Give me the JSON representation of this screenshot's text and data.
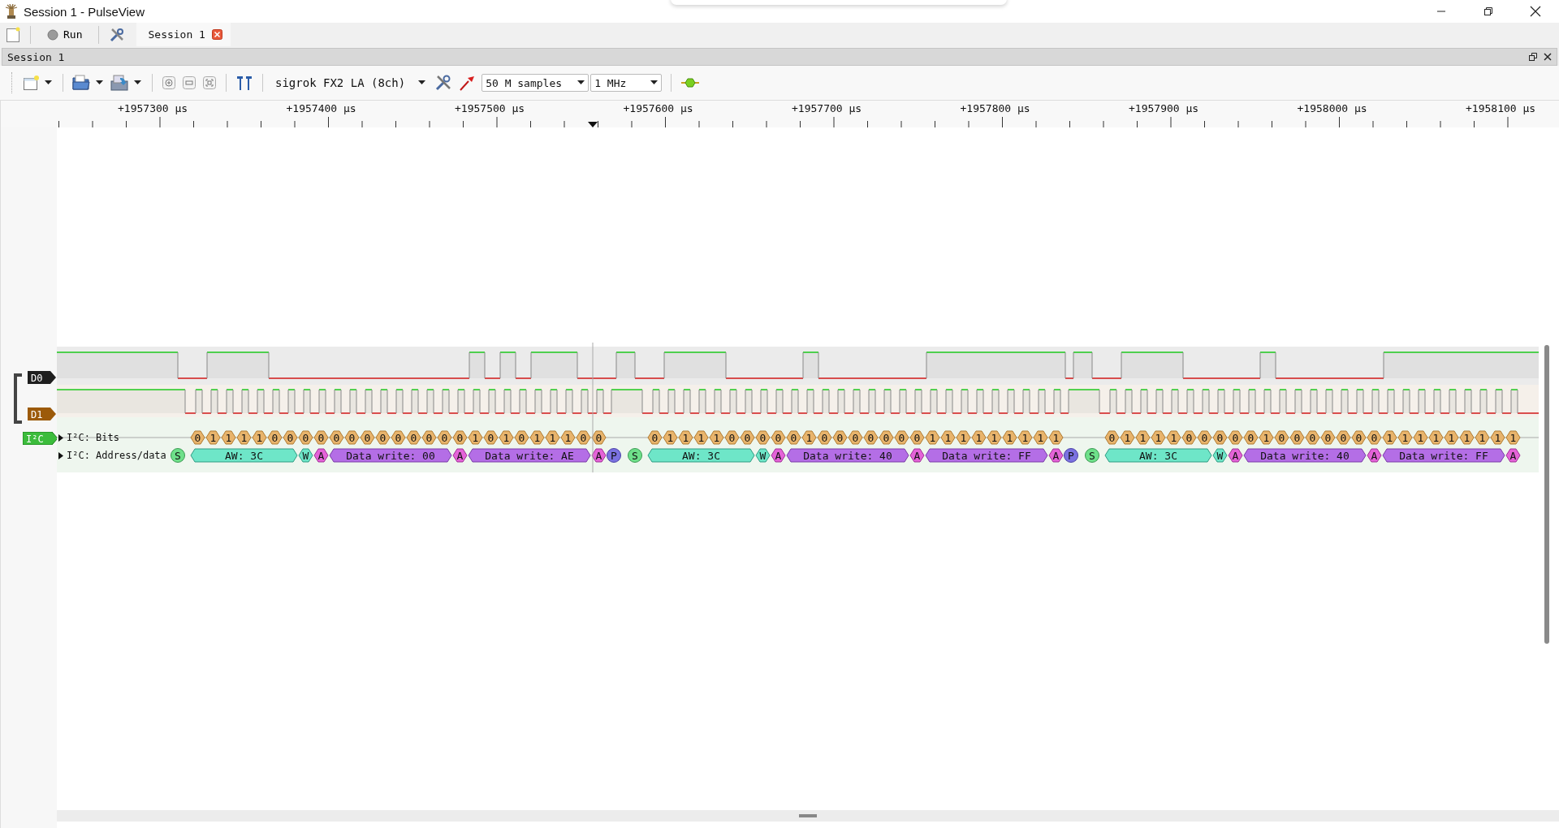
{
  "window": {
    "title": "Session 1 - PulseView"
  },
  "main_toolbar": {
    "run_label": "Run",
    "tabs": [
      {
        "label": "Session 1",
        "selected": true
      }
    ]
  },
  "session": {
    "title": "Session 1"
  },
  "session_toolbar": {
    "device": "sigrok FX2 LA (8ch)",
    "samples": "50 M samples",
    "samplerate": "1 MHz"
  },
  "ruler": {
    "labels": [
      "+1957300 μs",
      "+1957400 μs",
      "+1957500 μs",
      "+1957600 μs",
      "+1957700 μs",
      "+1957800 μs",
      "+1957900 μs",
      "+1958000 μs",
      "+1958100 μs"
    ]
  },
  "channels": [
    {
      "name": "D0",
      "color": "#1e1e1e"
    },
    {
      "name": "D1",
      "color": "#9c5a0a"
    }
  ],
  "decoder": {
    "name": "I²C",
    "rows": [
      {
        "label": "I²C: Bits"
      },
      {
        "label": "I²C: Address/data"
      }
    ],
    "annotations": [
      {
        "kind": "start",
        "text": "S"
      },
      {
        "kind": "address",
        "text": "AW: 3C",
        "bits": [
          "0",
          "1",
          "1",
          "1",
          "1",
          "0",
          "0"
        ]
      },
      {
        "kind": "rw",
        "text": "W",
        "bits": [
          "0"
        ]
      },
      {
        "kind": "ack",
        "text": "A",
        "bits": [
          "0"
        ]
      },
      {
        "kind": "data",
        "text": "Data write: 00",
        "bits": [
          "0",
          "0",
          "0",
          "0",
          "0",
          "0",
          "0",
          "0"
        ]
      },
      {
        "kind": "ack",
        "text": "A",
        "bits": [
          "0"
        ]
      },
      {
        "kind": "data",
        "text": "Data write: AE",
        "bits": [
          "1",
          "0",
          "1",
          "0",
          "1",
          "1",
          "1",
          "0"
        ]
      },
      {
        "kind": "ack",
        "text": "A",
        "bits": [
          "0"
        ]
      },
      {
        "kind": "stop",
        "text": "P"
      },
      {
        "kind": "start",
        "text": "S"
      },
      {
        "kind": "address",
        "text": "AW: 3C",
        "bits": [
          "0",
          "1",
          "1",
          "1",
          "1",
          "0",
          "0"
        ]
      },
      {
        "kind": "rw",
        "text": "W",
        "bits": [
          "0"
        ]
      },
      {
        "kind": "ack",
        "text": "A",
        "bits": [
          "0"
        ]
      },
      {
        "kind": "data",
        "text": "Data write: 40",
        "bits": [
          "0",
          "1",
          "0",
          "0",
          "0",
          "0",
          "0",
          "0"
        ]
      },
      {
        "kind": "ack",
        "text": "A",
        "bits": [
          "0"
        ]
      },
      {
        "kind": "data",
        "text": "Data write: FF",
        "bits": [
          "1",
          "1",
          "1",
          "1",
          "1",
          "1",
          "1",
          "1"
        ]
      },
      {
        "kind": "ack",
        "text": "A",
        "bits": [
          "1"
        ]
      },
      {
        "kind": "stop",
        "text": "P"
      },
      {
        "kind": "start",
        "text": "S"
      },
      {
        "kind": "address",
        "text": "AW: 3C",
        "bits": [
          "0",
          "1",
          "1",
          "1",
          "1",
          "0",
          "0"
        ]
      },
      {
        "kind": "rw",
        "text": "W",
        "bits": [
          "0"
        ]
      },
      {
        "kind": "ack",
        "text": "A",
        "bits": [
          "0"
        ]
      },
      {
        "kind": "data",
        "text": "Data write: 40",
        "bits": [
          "0",
          "1",
          "0",
          "0",
          "0",
          "0",
          "0",
          "0"
        ]
      },
      {
        "kind": "ack",
        "text": "A",
        "bits": [
          "0"
        ]
      },
      {
        "kind": "data",
        "text": "Data write: FF",
        "bits": [
          "1",
          "1",
          "1",
          "1",
          "1",
          "1",
          "1",
          "1"
        ]
      },
      {
        "kind": "ack",
        "text": "A",
        "bits": [
          "1"
        ]
      }
    ]
  }
}
